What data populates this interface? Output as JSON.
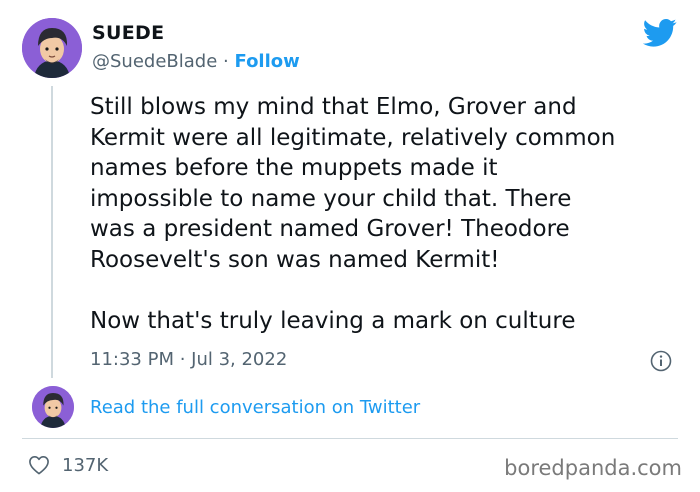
{
  "tweet": {
    "display_name": "SUEDE",
    "handle": "@SuedeBlade",
    "separator": "·",
    "follow_label": "Follow",
    "text_paragraph_1_lines": [
      "Still blows my mind that Elmo, Grover and",
      "Kermit were all legitimate, relatively common",
      "names before the muppets made it",
      "impossible to name your child that. There",
      "was a president named Grover! Theodore",
      "Roosevelt's son was named Kermit!"
    ],
    "text_paragraph_2": "Now that's truly leaving a mark on culture",
    "timestamp": "11:33 PM · Jul 3, 2022",
    "read_conversation_label": "Read the full conversation on Twitter",
    "like_count": "137K"
  },
  "watermark": "boredpanda.com",
  "colors": {
    "link": "#1d9bf0",
    "secondary_text": "#536471",
    "avatar_bg": "#8b5fd6"
  },
  "icons": {
    "brand": "twitter-bird-icon",
    "info": "info-icon",
    "like": "heart-icon"
  }
}
